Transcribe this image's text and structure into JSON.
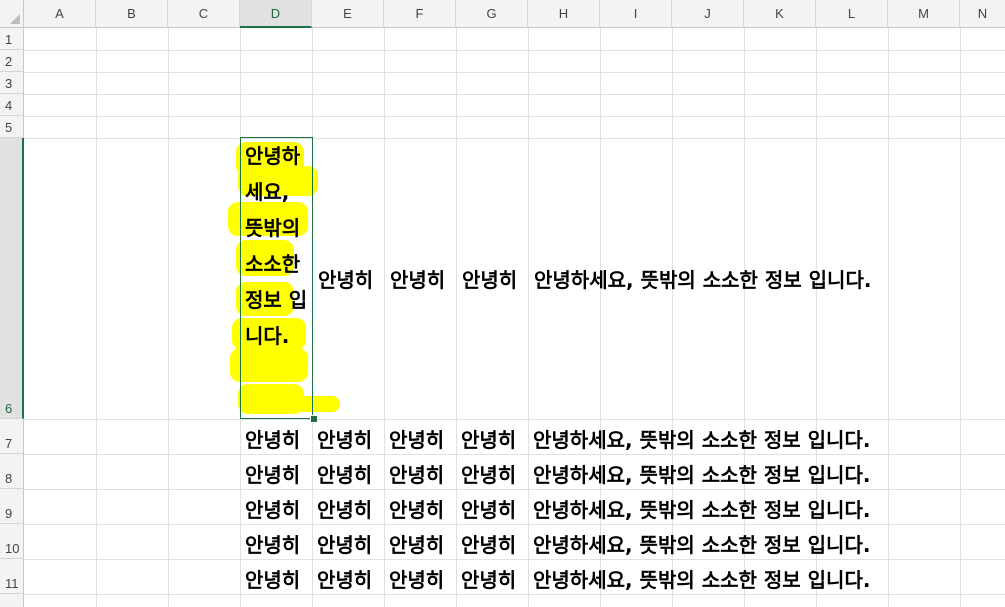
{
  "columns": [
    "A",
    "B",
    "C",
    "D",
    "E",
    "F",
    "G",
    "H",
    "I",
    "J",
    "K",
    "L",
    "M",
    "N"
  ],
  "rows": [
    "1",
    "2",
    "3",
    "4",
    "5",
    "6",
    "7",
    "8",
    "9",
    "10",
    "11"
  ],
  "selected_column": "D",
  "selected_row": "6",
  "cells": {
    "d6": "안녕하세요, 뜻밖의 소소한 정보 입니다.",
    "e6": "안녕히",
    "f6": "안녕히",
    "g6": "안녕히",
    "h6": "안녕하세요, 뜻밖의 소소한 정보 입니다.",
    "row_prefix": "안녕히",
    "row_tail": "안녕하세요, 뜻밖의 소소한 정보 입니다."
  },
  "colors": {
    "highlight": "#ffff00",
    "selection": "#1e7145",
    "header_bg": "#f3f3f3"
  }
}
